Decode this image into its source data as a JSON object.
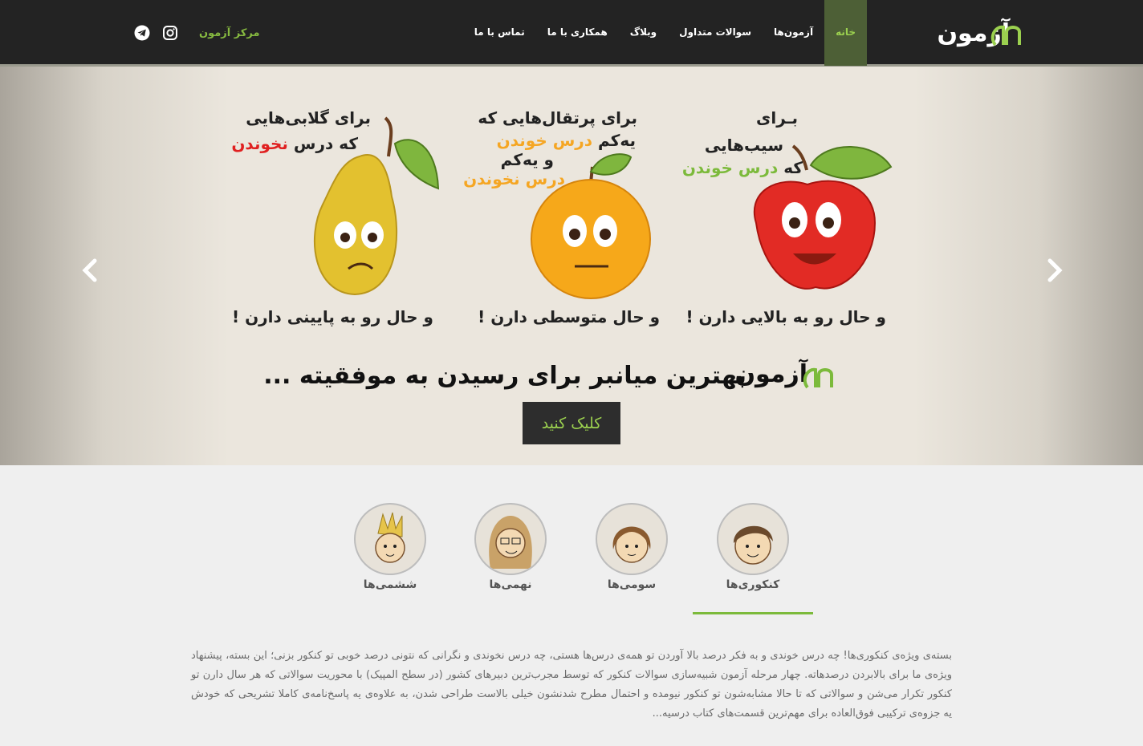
{
  "header": {
    "logo_text": "آزمون",
    "nav": [
      {
        "label": "خانه",
        "active": true
      },
      {
        "label": "آزمون‌ها",
        "active": false
      },
      {
        "label": "سوالات متداول",
        "active": false
      },
      {
        "label": "وبلاگ",
        "active": false
      },
      {
        "label": "همکاری با ما",
        "active": false
      },
      {
        "label": "تماس با ما",
        "active": false
      }
    ],
    "center_link": "مرکز آزمون",
    "social": [
      "telegram-icon",
      "instagram-icon"
    ],
    "accent": "#9bd04f"
  },
  "hero": {
    "apple": {
      "line1": "بـرای",
      "line2": "سیب‌هایی",
      "line3_pre": "که ",
      "line3_hl": "درس خوندن",
      "bottom": "و حال رو به بالایی دارن !"
    },
    "orange": {
      "line1": "برای پرتقال‌هایی که",
      "line2_pre": "یه‌کم ",
      "line2_hl": "درس خوندن",
      "line3": "و یه‌کم",
      "line4_hl": "درس نخوندن",
      "bottom": "و حال متوسطی دارن !"
    },
    "pear": {
      "line1": "برای گلابی‌هایی",
      "line2_pre": "که درس ",
      "line2_hl": "نخوندن",
      "bottom": "و حال رو به پایینی دارن !"
    },
    "tagline_logo": "آزمون",
    "tagline": "بهترین میانبر برای رسیدن به موفقیته ...",
    "cta": "کلیک کنید"
  },
  "tabs": [
    {
      "label": "کنکوری‌ها",
      "active": true
    },
    {
      "label": "سومی‌ها",
      "active": false
    },
    {
      "label": "نهمی‌ها",
      "active": false
    },
    {
      "label": "ششمی‌ها",
      "active": false
    }
  ],
  "description": "بسته‌ی ویژه‌ی کنکوری‌ها! چه درس خوندی و به فکر درصد بالا آوردن تو همه‌ی درس‌ها هستی، چه درس نخوندی و نگرانی که نتونی درصد خوبی تو کنکور بزنی؛ این بسته، پیشنهاد ویژه‌ی ما برای بالابردن درصدهاته. چهار مرحله آزمون شبیه‌سازی سوالات کنکور که توسط مجرب‌ترین دبیرهای کشور (در سطح المپیک) با محوریت سوالاتی که هر سال دارن تو کنکور تکرار می‌شن و سوالاتی که تا حالا مشابه‌شون تو کنکور نیومده و احتمال مطرح شدنشون خیلی بالاست طراحی شدن، به علاوه‌ی یه پاسخ‌نامه‌ی کاملا تشریحی که خودش یه جزوه‌ی ترکیبی فوق‌العاده برای مهم‌ترین قسمت‌های کتاب درسیه..."
}
